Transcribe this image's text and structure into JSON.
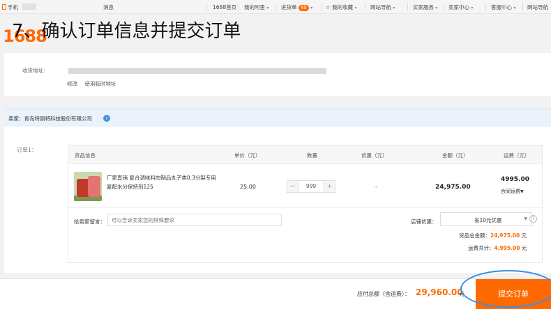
{
  "topbar": {
    "item0": "手机",
    "item1": "消息",
    "item2": "1688首页",
    "item3": "我的阿里",
    "cart_label": "进货单",
    "cart_count": "40",
    "item5": "我的收藏",
    "item6": "网站导航",
    "item7": "买家服务",
    "item8": "卖家中心",
    "item9": "客服中心",
    "item10": "网站导航"
  },
  "logo": "1688",
  "step_title": "7、确认订单信息并提交订单",
  "address": {
    "label": "收货地址：",
    "link_edit": "修改",
    "link_use": "使用临时地址"
  },
  "seller": {
    "label": "卖家：青岛特丽特科技股份有限公司"
  },
  "order": {
    "label": "订单1：",
    "headers": {
      "product": "货品信息",
      "unit_price": "单价（元）",
      "quantity": "数量",
      "discount": "优惠（元）",
      "amount": "金额（元）",
      "shipping": "运费（元）"
    },
    "item": {
      "name": "厂家直销 复合调味料肉制品丸子类0.3分裂专用 复配水分保持剂125",
      "unit_price": "25.00",
      "quantity": "999",
      "discount": "-",
      "amount": "24,975.00",
      "shipping": "4995.00",
      "shipping_option": "合同运费"
    },
    "message_label": "给卖家留言：",
    "message_placeholder": "可以告诉卖家您的特殊要求",
    "promo_label": "店铺优惠：",
    "promo_value": "省10元优惠",
    "subtotal_label": "货品总金额：",
    "subtotal_value": "24,975.00",
    "subtotal_unit": "元",
    "freight_label": "运费共计：",
    "freight_value": "4,995.00",
    "freight_unit": "元"
  },
  "footer": {
    "pay_label": "应付总额（含运费）：",
    "pay_amount": "29,960.00",
    "pay_unit": "元",
    "submit_label": "提交订单"
  },
  "colors": {
    "accent": "#ff6a00",
    "highlight_ring": "#3a8ee6",
    "seller_bg": "#eaf2fb"
  }
}
